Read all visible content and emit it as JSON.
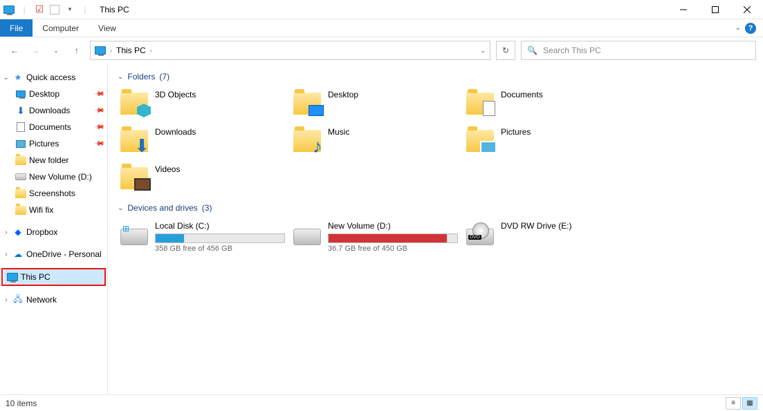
{
  "window": {
    "title": "This PC",
    "file_tab": "File",
    "tabs": [
      "Computer",
      "View"
    ]
  },
  "nav": {
    "location": "This PC",
    "search_placeholder": "Search This PC"
  },
  "sidebar": {
    "quick_access": "Quick access",
    "items": [
      {
        "label": "Desktop",
        "pinned": true,
        "icon": "desktop"
      },
      {
        "label": "Downloads",
        "pinned": true,
        "icon": "downloads"
      },
      {
        "label": "Documents",
        "pinned": true,
        "icon": "documents"
      },
      {
        "label": "Pictures",
        "pinned": true,
        "icon": "pictures"
      },
      {
        "label": "New folder",
        "pinned": false,
        "icon": "folder"
      },
      {
        "label": "New Volume (D:)",
        "pinned": false,
        "icon": "drive"
      },
      {
        "label": "Screenshots",
        "pinned": false,
        "icon": "folder"
      },
      {
        "label": "Wifi fix",
        "pinned": false,
        "icon": "folder"
      }
    ],
    "dropbox": "Dropbox",
    "onedrive": "OneDrive - Personal",
    "this_pc": "This PC",
    "network": "Network"
  },
  "sections": {
    "folders": {
      "title": "Folders",
      "count": "(7)"
    },
    "drives": {
      "title": "Devices and drives",
      "count": "(3)"
    }
  },
  "folders": [
    {
      "name": "3D Objects",
      "icon": "3dobjects"
    },
    {
      "name": "Desktop",
      "icon": "desktop"
    },
    {
      "name": "Documents",
      "icon": "documents"
    },
    {
      "name": "Downloads",
      "icon": "downloads"
    },
    {
      "name": "Music",
      "icon": "music"
    },
    {
      "name": "Pictures",
      "icon": "pictures"
    },
    {
      "name": "Videos",
      "icon": "videos"
    }
  ],
  "drives": [
    {
      "name": "Local Disk (C:)",
      "sub": "358 GB free of 456 GB",
      "fill_class": "blue",
      "fill_pct": 22,
      "icon": "windrive"
    },
    {
      "name": "New Volume (D:)",
      "sub": "36.7 GB free of 450 GB",
      "fill_class": "red",
      "fill_pct": 92,
      "icon": "drive"
    },
    {
      "name": "DVD RW Drive (E:)",
      "sub": "",
      "fill_class": "",
      "fill_pct": 0,
      "icon": "dvd"
    }
  ],
  "status": {
    "text": "10 items"
  }
}
